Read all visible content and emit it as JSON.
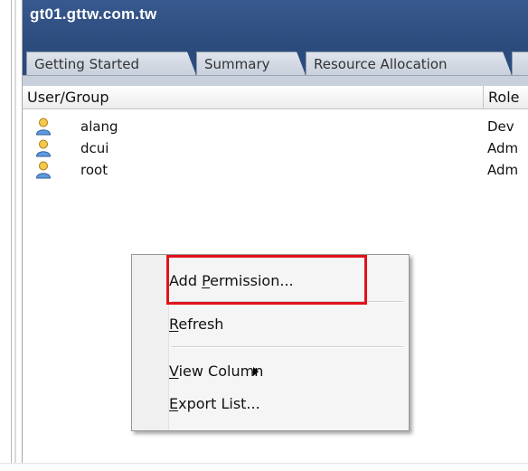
{
  "window": {
    "title": "gt01.gttw.com.tw"
  },
  "tabs": [
    {
      "label": "Getting Started"
    },
    {
      "label": "Summary"
    },
    {
      "label": "Resource Allocation"
    }
  ],
  "columns": {
    "user_group": "User/Group",
    "role": "Role"
  },
  "rows": [
    {
      "name": "alang",
      "role": "Dev"
    },
    {
      "name": "dcui",
      "role": "Adm"
    },
    {
      "name": "root",
      "role": "Adm"
    }
  ],
  "context_menu": {
    "items": [
      {
        "pre": "Add ",
        "acc": "P",
        "post": "ermission..."
      },
      {
        "pre": "",
        "acc": "R",
        "post": "efresh"
      },
      {
        "pre": "",
        "acc": "V",
        "post": "iew Column"
      },
      {
        "pre": "",
        "acc": "E",
        "post": "xport List..."
      }
    ]
  },
  "icons": {
    "user": "user-icon",
    "submenu_arrow": "chevron-right-icon"
  },
  "colors": {
    "header_bg": "#2c4b7d",
    "highlight": "#e1121b"
  }
}
